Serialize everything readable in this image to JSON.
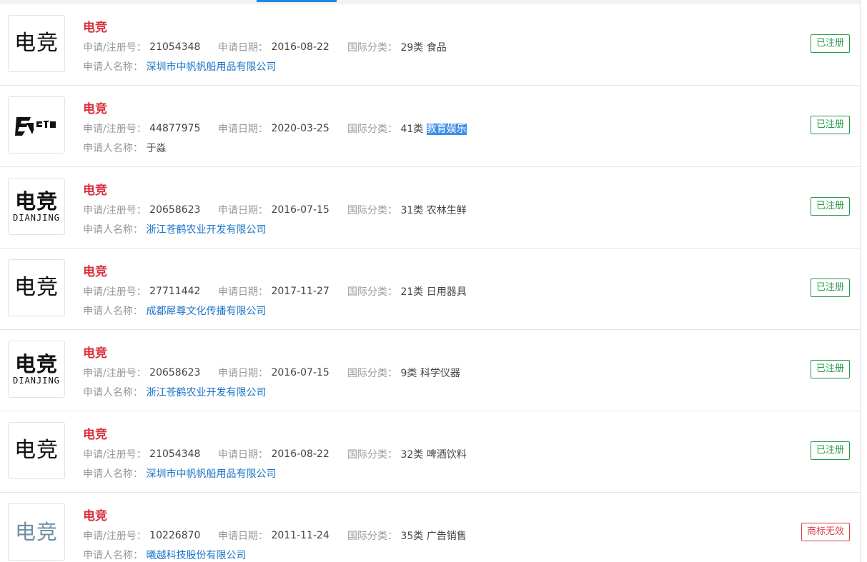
{
  "labels": {
    "reg_no": "申请/注册号：",
    "date": "申请日期：",
    "intl_class": "国际分类：",
    "applicant": "申请人名称："
  },
  "colors": {
    "name_red": "#d9303e",
    "link_blue": "#1a73c8",
    "registered_green": "#2a9a4a",
    "invalid_red": "#e0404a"
  },
  "rows": [
    {
      "logo_text": "电竞",
      "logo_style": "serif",
      "name": "电竞",
      "reg_no": "21054348",
      "date": "2016-08-22",
      "class_num": "29类",
      "class_name": "食品",
      "applicant": "深圳市中帆帆船用品有限公司",
      "applicant_link": true,
      "status": "已注册"
    },
    {
      "logo_text": "",
      "logo_style": "graphic",
      "logo_icon": "esports-emblem-icon",
      "name": "电竞",
      "reg_no": "44877975",
      "date": "2020-03-25",
      "class_num": "41类",
      "class_name": "教育娱乐",
      "class_selected": true,
      "applicant": "于淼",
      "applicant_link": false,
      "status": "已注册"
    },
    {
      "logo_text": "电竞",
      "logo_sub": "DIANJING",
      "logo_style": "stack",
      "name": "电竞",
      "reg_no": "20658623",
      "date": "2016-07-15",
      "class_num": "31类",
      "class_name": "农林生鲜",
      "applicant": "浙江苍鹤农业开发有限公司",
      "applicant_link": true,
      "status": "已注册"
    },
    {
      "logo_text": "电竞",
      "logo_style": "serif",
      "name": "电竞",
      "reg_no": "27711442",
      "date": "2017-11-27",
      "class_num": "21类",
      "class_name": "日用器具",
      "applicant": "成都犀尊文化传播有限公司",
      "applicant_link": true,
      "status": "已注册"
    },
    {
      "logo_text": "电竞",
      "logo_sub": "DIANJING",
      "logo_style": "stack",
      "name": "电竞",
      "reg_no": "20658623",
      "date": "2016-07-15",
      "class_num": "9类",
      "class_name": "科学仪器",
      "applicant": "浙江苍鹤农业开发有限公司",
      "applicant_link": true,
      "status": "已注册"
    },
    {
      "logo_text": "电竞",
      "logo_style": "serif",
      "name": "电竞",
      "reg_no": "21054348",
      "date": "2016-08-22",
      "class_num": "32类",
      "class_name": "啤酒饮料",
      "applicant": "深圳市中帆帆船用品有限公司",
      "applicant_link": true,
      "status": "已注册"
    },
    {
      "logo_text": "电竞",
      "logo_style": "serif-faded",
      "name": "电竞",
      "reg_no": "10226870",
      "date": "2011-11-24",
      "class_num": "35类",
      "class_name": "广告销售",
      "applicant": "曦越科技股份有限公司",
      "applicant_link": true,
      "status": "商标无效",
      "status_invalid": true
    }
  ]
}
